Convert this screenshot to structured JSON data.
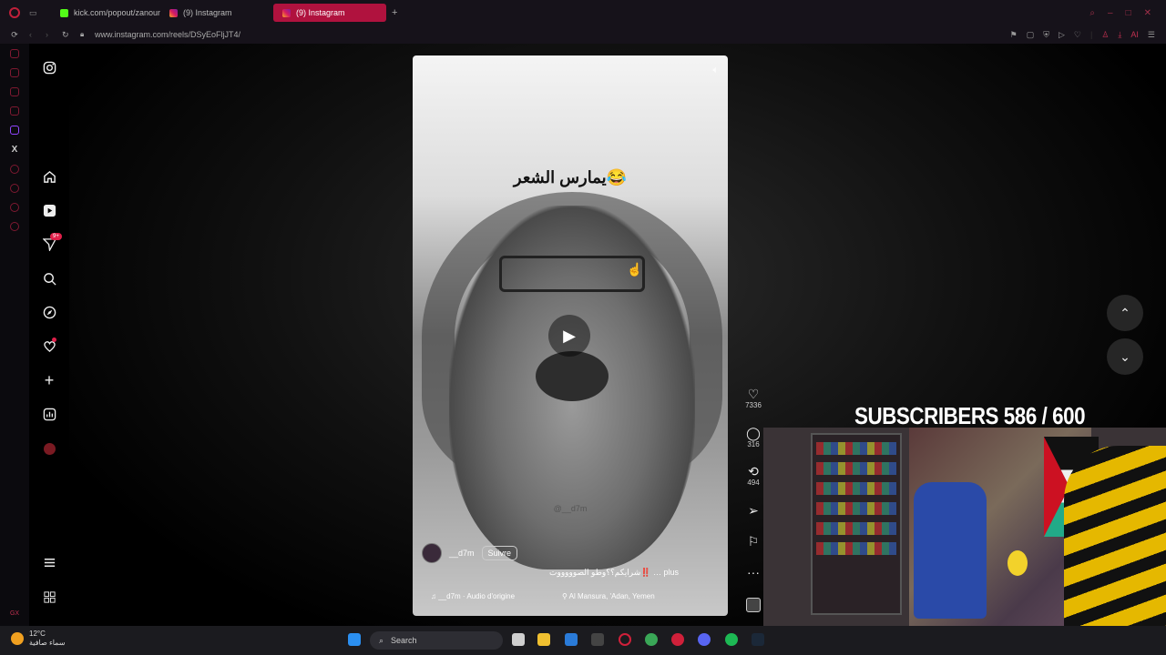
{
  "browser": {
    "tabs": [
      {
        "label": "kick.com/popout/zanoun…",
        "active": false
      },
      {
        "label": "(9) Instagram",
        "active": false
      },
      {
        "label": "(9) Instagram",
        "active": true
      }
    ],
    "new_tab_symbol": "+",
    "url": "www.instagram.com/reels/DSyEoFljJT4/",
    "toolbar_ai_label": "AI"
  },
  "instagram_nav": {
    "logo_icon": "instagram-icon",
    "items": [
      {
        "name": "home",
        "icon": "home-icon"
      },
      {
        "name": "reels",
        "icon": "reels-icon"
      },
      {
        "name": "messages",
        "icon": "send-icon",
        "badge": "9+"
      },
      {
        "name": "search",
        "icon": "search-icon"
      },
      {
        "name": "explore",
        "icon": "compass-icon"
      },
      {
        "name": "notifications",
        "icon": "heart-icon"
      },
      {
        "name": "create",
        "icon": "plus-icon"
      },
      {
        "name": "dashboard",
        "icon": "chart-icon"
      },
      {
        "name": "profile",
        "icon": "avatar-icon"
      }
    ],
    "more_icon": "menu-icon",
    "threads_icon": "apps-icon"
  },
  "reel": {
    "caption_overlay": "يمارس الشعر😂",
    "watermark": "@__d7m",
    "author": "__d7m",
    "follow_label": "Suivre",
    "caption": "شرايكم؟؟وطو الصوووووت‼️ … plus",
    "audio": "__d7m · Audio d'origine",
    "location": "Al Mansura, 'Adan, Yemen"
  },
  "actions": {
    "likes": "7336",
    "comments": "316",
    "reposts": "494"
  },
  "stream_overlay": {
    "subscribers": "SUBSCRIBERS 586 / 600"
  },
  "taskbar": {
    "temperature": "12°C",
    "weather_text": "سماء صافية",
    "search_placeholder": "Search"
  },
  "colors": {
    "accent": "#b0123e",
    "badge": "#e0204a"
  }
}
